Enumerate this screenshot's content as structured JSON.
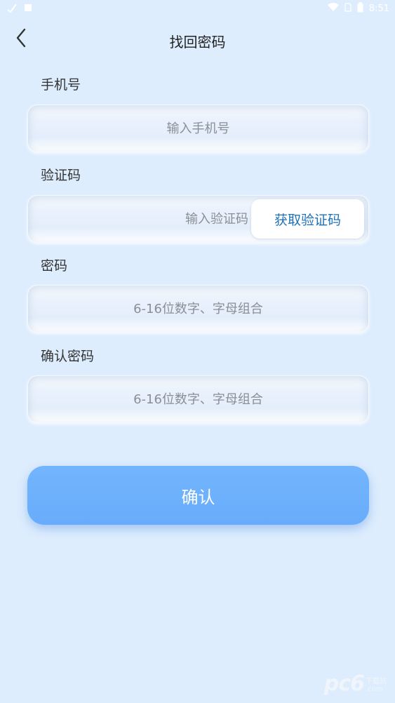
{
  "status_bar": {
    "time": "8:51",
    "icons_left": [
      "check-icon",
      "notification-icon"
    ],
    "icons_right": [
      "wifi-icon",
      "no-sim-icon",
      "battery-icon"
    ]
  },
  "nav": {
    "title": "找回密码"
  },
  "form": {
    "phone": {
      "label": "手机号",
      "placeholder": "输入手机号",
      "value": ""
    },
    "code": {
      "label": "验证码",
      "placeholder": "输入验证码",
      "value": "",
      "button_label": "获取验证码"
    },
    "password": {
      "label": "密码",
      "placeholder": "6-16位数字、字母组合",
      "value": ""
    },
    "confirm_password": {
      "label": "确认密码",
      "placeholder": "6-16位数字、字母组合",
      "value": ""
    }
  },
  "confirm_button": {
    "label": "确认"
  },
  "watermark": {
    "logo": "pc6",
    "badge": "下载站",
    "domain": ".com"
  },
  "colors": {
    "background": "#deedfd",
    "accent": "#6aaefb",
    "link": "#1e72b8"
  }
}
